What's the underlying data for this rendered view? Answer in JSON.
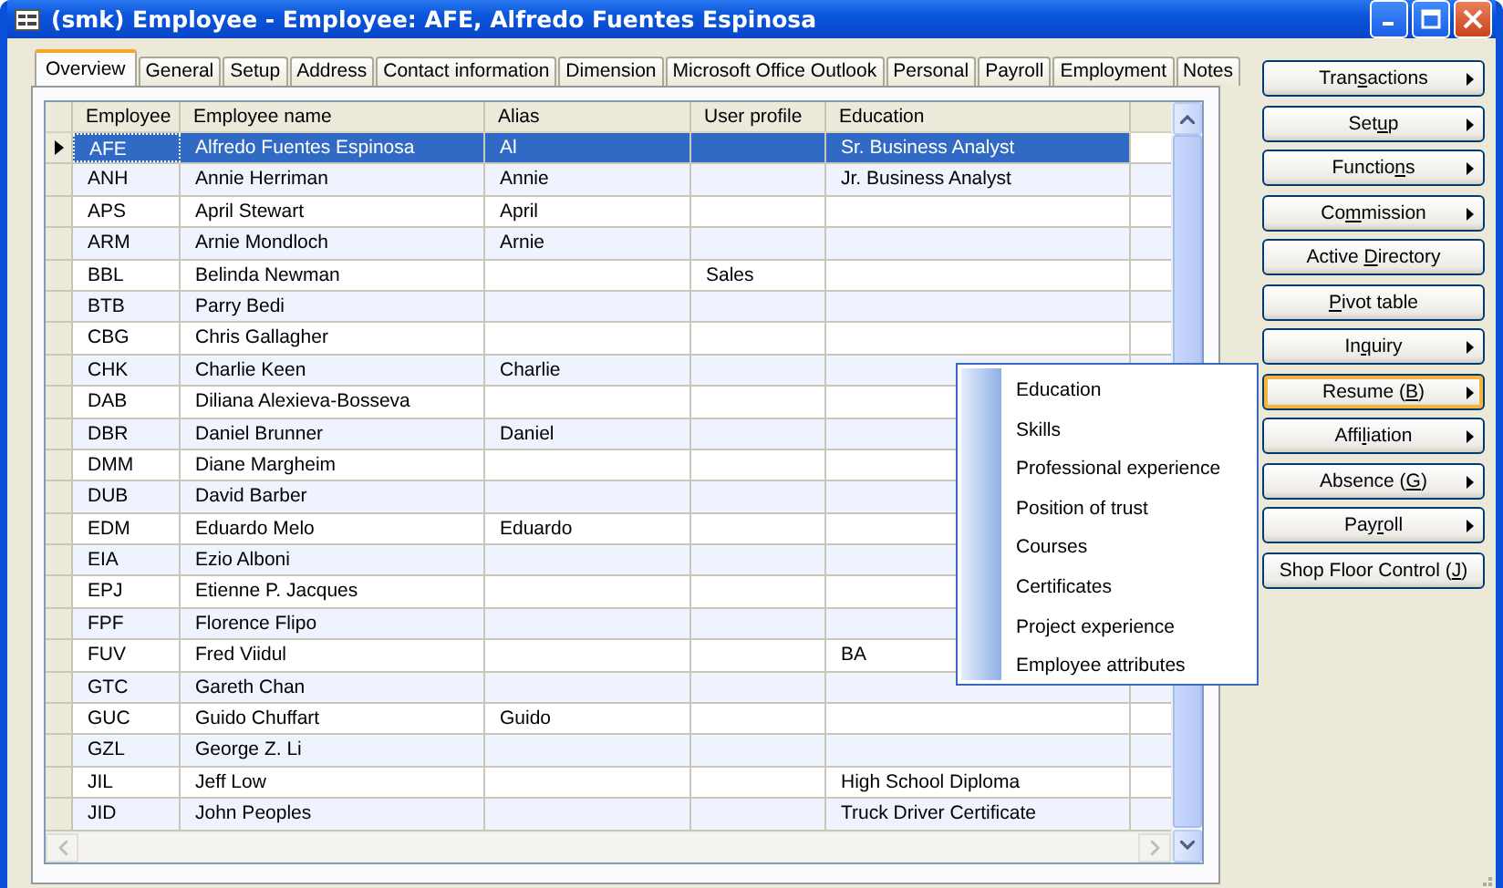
{
  "window": {
    "title": "(smk) Employee - Employee: AFE, Alfredo Fuentes Espinosa"
  },
  "tabs": [
    {
      "label": "Overview",
      "selected": true
    },
    {
      "label": "General",
      "selected": false
    },
    {
      "label": "Setup",
      "selected": false
    },
    {
      "label": "Address",
      "selected": false
    },
    {
      "label": "Contact information",
      "selected": false
    },
    {
      "label": "Dimension",
      "selected": false
    },
    {
      "label": "Microsoft Office Outlook",
      "selected": false
    },
    {
      "label": "Personal",
      "selected": false
    },
    {
      "label": "Payroll",
      "selected": false
    },
    {
      "label": "Employment",
      "selected": false
    },
    {
      "label": "Notes",
      "selected": false
    }
  ],
  "table": {
    "columns": [
      "Employee",
      "Employee name",
      "Alias",
      "User profile",
      "Education"
    ],
    "rows": [
      {
        "cells": [
          "AFE",
          "Alfredo Fuentes Espinosa",
          "Al",
          "",
          "Sr. Business Analyst"
        ],
        "selected": true
      },
      {
        "cells": [
          "ANH",
          "Annie Herriman",
          "Annie",
          "",
          "Jr. Business Analyst"
        ],
        "selected": false
      },
      {
        "cells": [
          "APS",
          "April Stewart",
          "April",
          "",
          ""
        ],
        "selected": false
      },
      {
        "cells": [
          "ARM",
          "Arnie Mondloch",
          "Arnie",
          "",
          ""
        ],
        "selected": false
      },
      {
        "cells": [
          "BBL",
          "Belinda Newman",
          "",
          "Sales",
          ""
        ],
        "selected": false
      },
      {
        "cells": [
          "BTB",
          "Parry Bedi",
          "",
          "",
          ""
        ],
        "selected": false
      },
      {
        "cells": [
          "CBG",
          "Chris Gallagher",
          "",
          "",
          ""
        ],
        "selected": false
      },
      {
        "cells": [
          "CHK",
          "Charlie Keen",
          "Charlie",
          "",
          ""
        ],
        "selected": false
      },
      {
        "cells": [
          "DAB",
          "Diliana Alexieva-Bosseva",
          "",
          "",
          ""
        ],
        "selected": false
      },
      {
        "cells": [
          "DBR",
          "Daniel Brunner",
          "Daniel",
          "",
          ""
        ],
        "selected": false
      },
      {
        "cells": [
          "DMM",
          "Diane Margheim",
          "",
          "",
          ""
        ],
        "selected": false
      },
      {
        "cells": [
          "DUB",
          "David Barber",
          "",
          "",
          ""
        ],
        "selected": false
      },
      {
        "cells": [
          "EDM",
          "Eduardo Melo",
          "Eduardo",
          "",
          ""
        ],
        "selected": false
      },
      {
        "cells": [
          "EIA",
          "Ezio Alboni",
          "",
          "",
          ""
        ],
        "selected": false
      },
      {
        "cells": [
          "EPJ",
          "Etienne P. Jacques",
          "",
          "",
          ""
        ],
        "selected": false
      },
      {
        "cells": [
          "FPF",
          "Florence Flipo",
          "",
          "",
          ""
        ],
        "selected": false
      },
      {
        "cells": [
          "FUV",
          "Fred Viidul",
          "",
          "",
          "BA"
        ],
        "selected": false
      },
      {
        "cells": [
          "GTC",
          "Gareth Chan",
          "",
          "",
          ""
        ],
        "selected": false
      },
      {
        "cells": [
          "GUC",
          "Guido Chuffart",
          "Guido",
          "",
          ""
        ],
        "selected": false
      },
      {
        "cells": [
          "GZL",
          "George Z. Li",
          "",
          "",
          ""
        ],
        "selected": false
      },
      {
        "cells": [
          "JIL",
          "Jeff Low",
          "",
          "",
          "High School Diploma"
        ],
        "selected": false
      },
      {
        "cells": [
          "JID",
          "John Peoples",
          "",
          "",
          "Truck Driver Certificate"
        ],
        "selected": false
      }
    ]
  },
  "buttons": [
    {
      "before": "Tran",
      "key": "s",
      "after": "actions",
      "submenu": true,
      "focused": false
    },
    {
      "before": "Set",
      "key": "u",
      "after": "p",
      "submenu": true,
      "focused": false
    },
    {
      "before": "Functio",
      "key": "n",
      "after": "s",
      "submenu": true,
      "focused": false
    },
    {
      "before": "Co",
      "key": "m",
      "after": "mission",
      "submenu": true,
      "focused": false
    },
    {
      "before": "Active ",
      "key": "D",
      "after": "irectory",
      "submenu": false,
      "focused": false
    },
    {
      "key": "P",
      "after": "ivot table",
      "submenu": false,
      "focused": false
    },
    {
      "before": "In",
      "key": "q",
      "after": "uiry",
      "submenu": true,
      "focused": false
    },
    {
      "before": "Resume (",
      "key": "B",
      "after": ")",
      "submenu": true,
      "focused": true
    },
    {
      "before": "Affi",
      "key": "l",
      "after": "iation",
      "submenu": true,
      "focused": false
    },
    {
      "before": "Absence (",
      "key": "G",
      "after": ")",
      "submenu": true,
      "focused": false
    },
    {
      "before": "Pay",
      "key": "r",
      "after": "oll",
      "submenu": true,
      "focused": false
    },
    {
      "before": "Shop Floor Control (",
      "key": "J",
      "after": ")",
      "submenu": false,
      "focused": false
    }
  ],
  "popup_menu": {
    "items": [
      "Education",
      "Skills",
      "Professional experience",
      "Position of trust",
      "Courses",
      "Certificates",
      "Project experience",
      "Employee attributes"
    ]
  }
}
